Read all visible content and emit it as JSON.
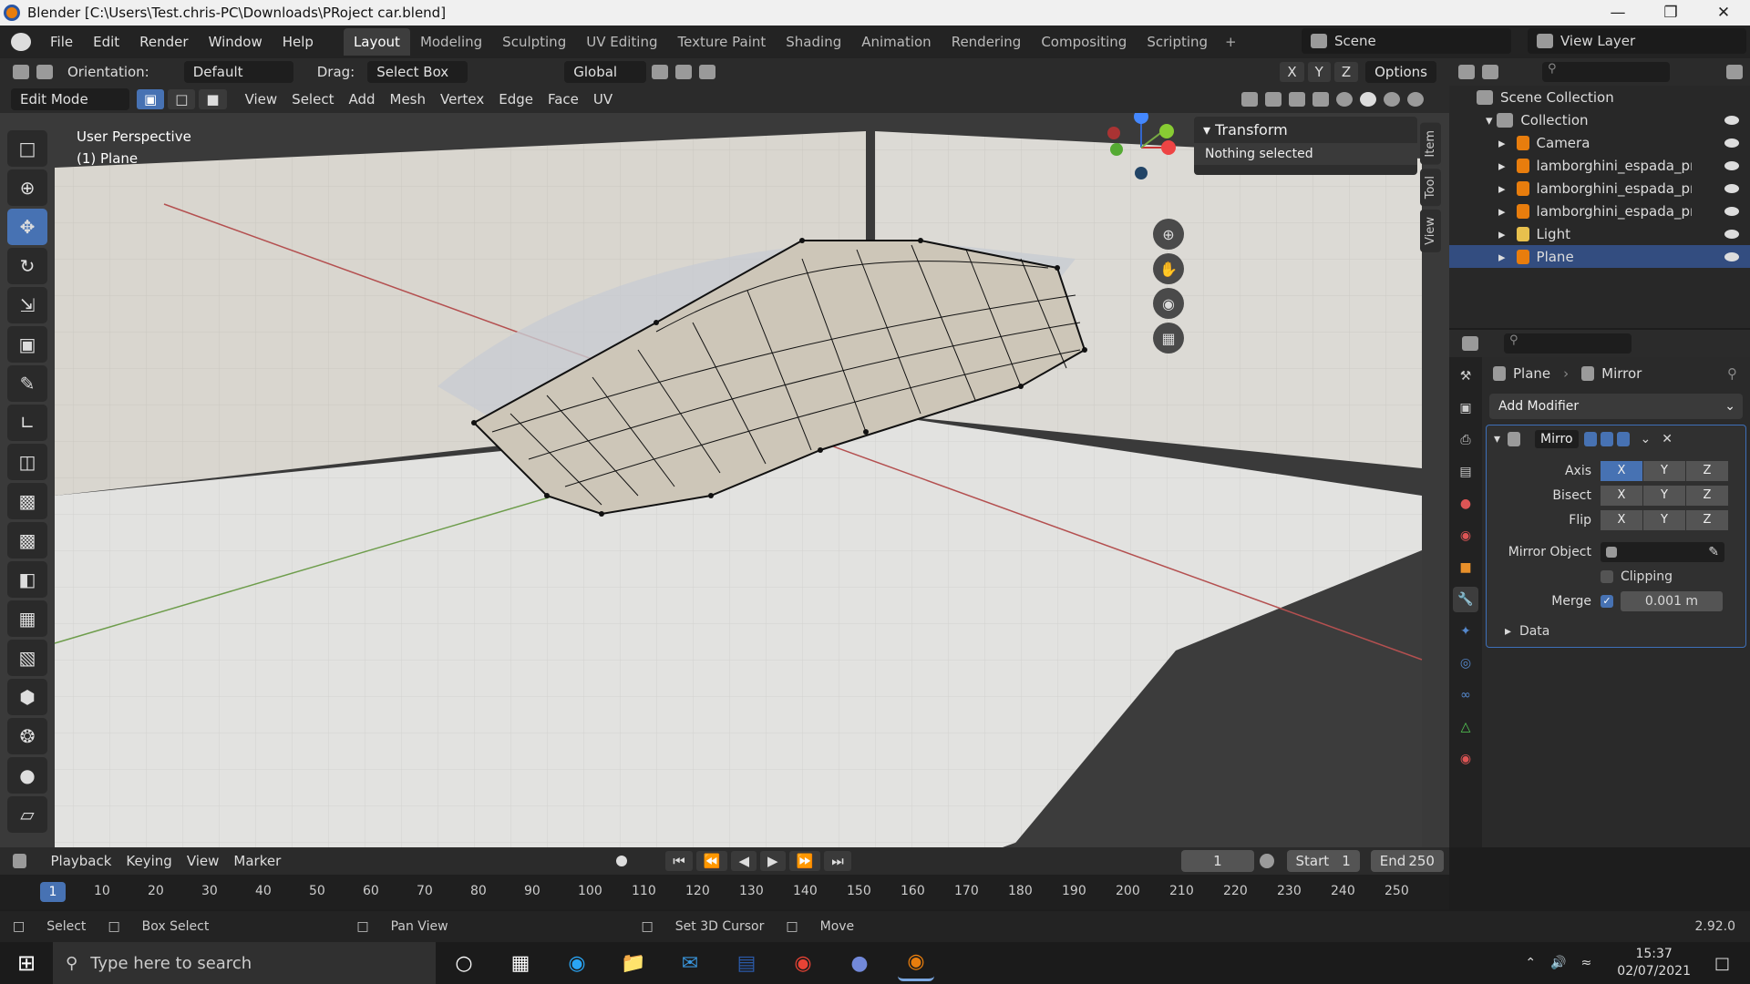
{
  "window": {
    "title": "Blender [C:\\Users\\Test.chris-PC\\Downloads\\PRoject car.blend]"
  },
  "menu": [
    "File",
    "Edit",
    "Render",
    "Window",
    "Help"
  ],
  "workspaces": [
    "Layout",
    "Modeling",
    "Sculpting",
    "UV Editing",
    "Texture Paint",
    "Shading",
    "Animation",
    "Rendering",
    "Compositing",
    "Scripting"
  ],
  "active_workspace": "Layout",
  "scene": "Scene",
  "view_layer": "View Layer",
  "header": {
    "orientation_label": "Orientation:",
    "orientation_value": "Default",
    "drag_label": "Drag:",
    "drag_value": "Select Box",
    "transform_orientation": "Global",
    "options": "Options",
    "axes": [
      "X",
      "Y",
      "Z"
    ]
  },
  "header2": {
    "mode": "Edit Mode",
    "menus": [
      "View",
      "Select",
      "Add",
      "Mesh",
      "Vertex",
      "Edge",
      "Face",
      "UV"
    ]
  },
  "viewport": {
    "line1": "User Perspective",
    "line2": "(1) Plane",
    "transform_title": "Transform",
    "transform_body": "Nothing selected",
    "sidebar_tabs": [
      "Item",
      "Tool",
      "View"
    ]
  },
  "outliner": {
    "scene_collection": "Scene Collection",
    "collection": "Collection",
    "items": [
      "Camera",
      "lamborghini_espada_prodi",
      "lamborghini_espada_prodi",
      "lamborghini_espada_prodi",
      "Light",
      "Plane"
    ]
  },
  "properties": {
    "object": "Plane",
    "modifier_crumb": "Mirror",
    "add_modifier": "Add Modifier",
    "modifier_name": "Mirro",
    "axis_label": "Axis",
    "bisect_label": "Bisect",
    "flip_label": "Flip",
    "mirror_object_label": "Mirror Object",
    "clipping_label": "Clipping",
    "merge_label": "Merge",
    "merge_value": "0.001 m",
    "data_label": "Data",
    "axes": [
      "X",
      "Y",
      "Z"
    ]
  },
  "timeline": {
    "menus": [
      "Playback",
      "Keying",
      "View",
      "Marker"
    ],
    "current_frame": "1",
    "start_label": "Start",
    "start_value": "1",
    "end_label": "End",
    "end_value": "250",
    "ruler_current": "1",
    "ticks": [
      "10",
      "20",
      "30",
      "40",
      "50",
      "60",
      "70",
      "80",
      "90",
      "100",
      "110",
      "120",
      "130",
      "140",
      "150",
      "160",
      "170",
      "180",
      "190",
      "200",
      "210",
      "220",
      "230",
      "240",
      "250"
    ]
  },
  "statusbar": {
    "select": "Select",
    "box_select": "Box Select",
    "pan_view": "Pan View",
    "set_cursor": "Set 3D Cursor",
    "move": "Move",
    "version": "2.92.0"
  },
  "taskbar": {
    "search_placeholder": "Type here to search",
    "time": "15:37",
    "date": "02/07/2021"
  }
}
